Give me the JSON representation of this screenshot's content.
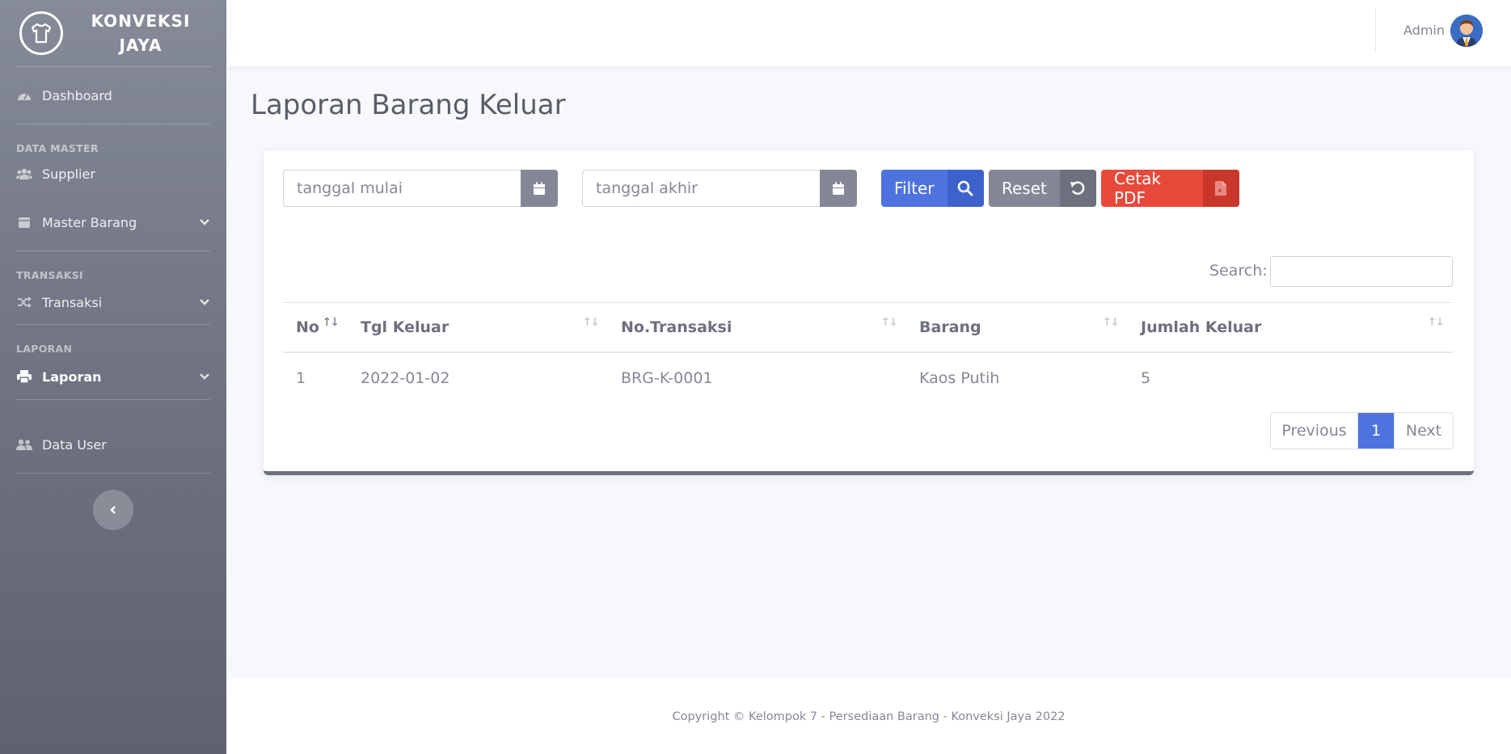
{
  "brand": {
    "line1": "KONVEKSI",
    "line2": "JAYA"
  },
  "sidebar": {
    "dashboard": "Dashboard",
    "heading_master": "DATA MASTER",
    "supplier": "Supplier",
    "master_barang": "Master Barang",
    "heading_transaksi": "TRANSAKSI",
    "transaksi": "Transaksi",
    "heading_laporan": "LAPORAN",
    "laporan": "Laporan",
    "data_user": "Data User"
  },
  "topbar": {
    "user_name": "Admin"
  },
  "page": {
    "title": "Laporan Barang Keluar"
  },
  "filters": {
    "start_placeholder": "tanggal mulai",
    "end_placeholder": "tanggal akhir",
    "filter_label": "Filter",
    "reset_label": "Reset",
    "pdf_label": "Cetak PDF"
  },
  "search": {
    "label": "Search:"
  },
  "table": {
    "headers": [
      "No",
      "Tgl Keluar",
      "No.Transaksi",
      "Barang",
      "Jumlah Keluar"
    ],
    "rows": [
      [
        "1",
        "2022-01-02",
        "BRG-K-0001",
        "Kaos Putih",
        "5"
      ]
    ]
  },
  "pagination": {
    "previous": "Previous",
    "current": "1",
    "next": "Next"
  },
  "footer": {
    "copyright": "Copyright © Kelompok 7 - Persediaan Barang - Konveksi Jaya 2022"
  },
  "colors": {
    "primary": "#4e73df",
    "secondary": "#858796",
    "danger": "#e74a3b"
  }
}
